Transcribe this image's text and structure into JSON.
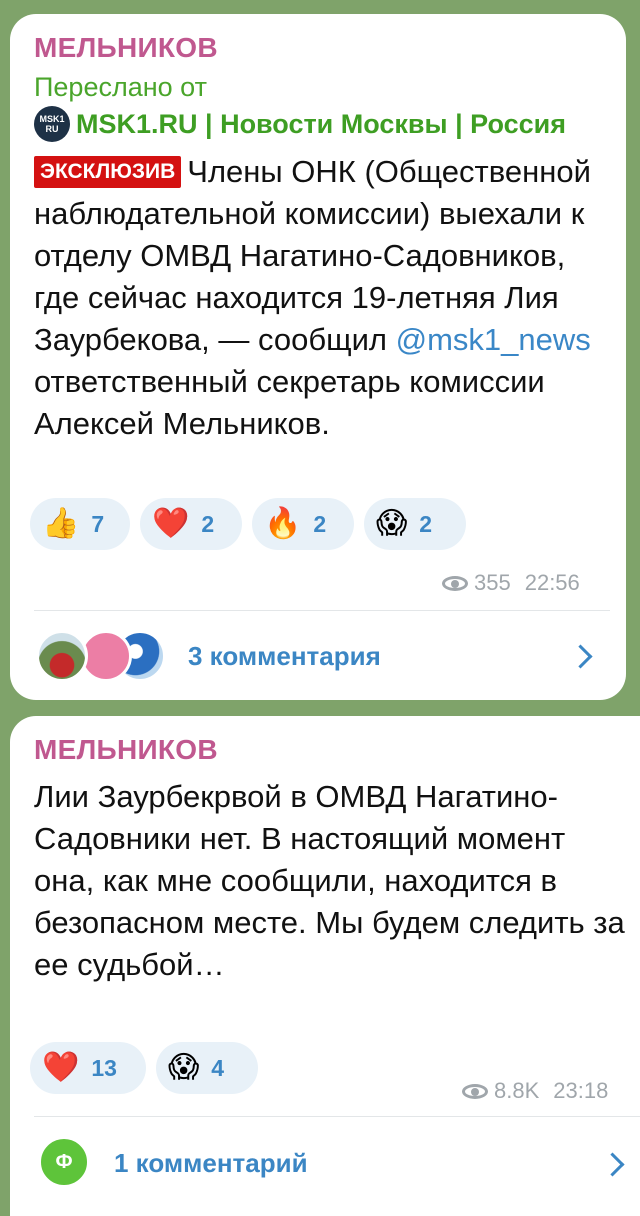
{
  "message1": {
    "author": "МЕЛЬНИКОВ",
    "forwarded_label": "Переслано от",
    "source_logo_text": "MSK1",
    "source_logo_sub": "RU",
    "source_name": "MSK1.RU | Новости Москвы | Россия",
    "tag": "ЭКСКЛЮЗИВ",
    "text_before": "Члены ОНК (Общественной наблюдательной комиссии) выехали к отделу ОМВД Нагатино-Садовников, где сейчас находится 19-летняя Лия Заурбекова, — сообщил ",
    "mention": "@msk1_news",
    "text_after": " ответственный секретарь комиссии Алексей Мельников.",
    "reactions": [
      {
        "icon": "thumbs-up-icon",
        "emoji": "👍",
        "count": "7"
      },
      {
        "icon": "heart-icon",
        "emoji": "❤️",
        "count": "2"
      },
      {
        "icon": "fire-icon",
        "emoji": "🔥",
        "count": "2"
      },
      {
        "icon": "scream-icon",
        "emoji": "😱",
        "count": "2"
      }
    ],
    "views": "355",
    "time": "22:56",
    "comments": "3 комментария"
  },
  "message2": {
    "author": "МЕЛЬНИКОВ",
    "text": "Лии Заурбекрвой в ОМВД Нагатино-Садовники нет. В настоящий момент она, как мне сообщили, находится в безопасном месте. Мы будем следить за ее судьбой…",
    "reactions": [
      {
        "icon": "heart-icon",
        "emoji": "❤️",
        "count": "13"
      },
      {
        "icon": "scream-icon",
        "emoji": "😱",
        "count": "4"
      }
    ],
    "views": "8.8K",
    "time": "23:18",
    "commenter_initial": "Ф",
    "comments": "1 комментарий"
  },
  "colors": {
    "background": "#7fa36a",
    "author": "#c0588f",
    "forward": "#4aa52b",
    "link": "#3b86c4",
    "tag": "#d41111"
  }
}
